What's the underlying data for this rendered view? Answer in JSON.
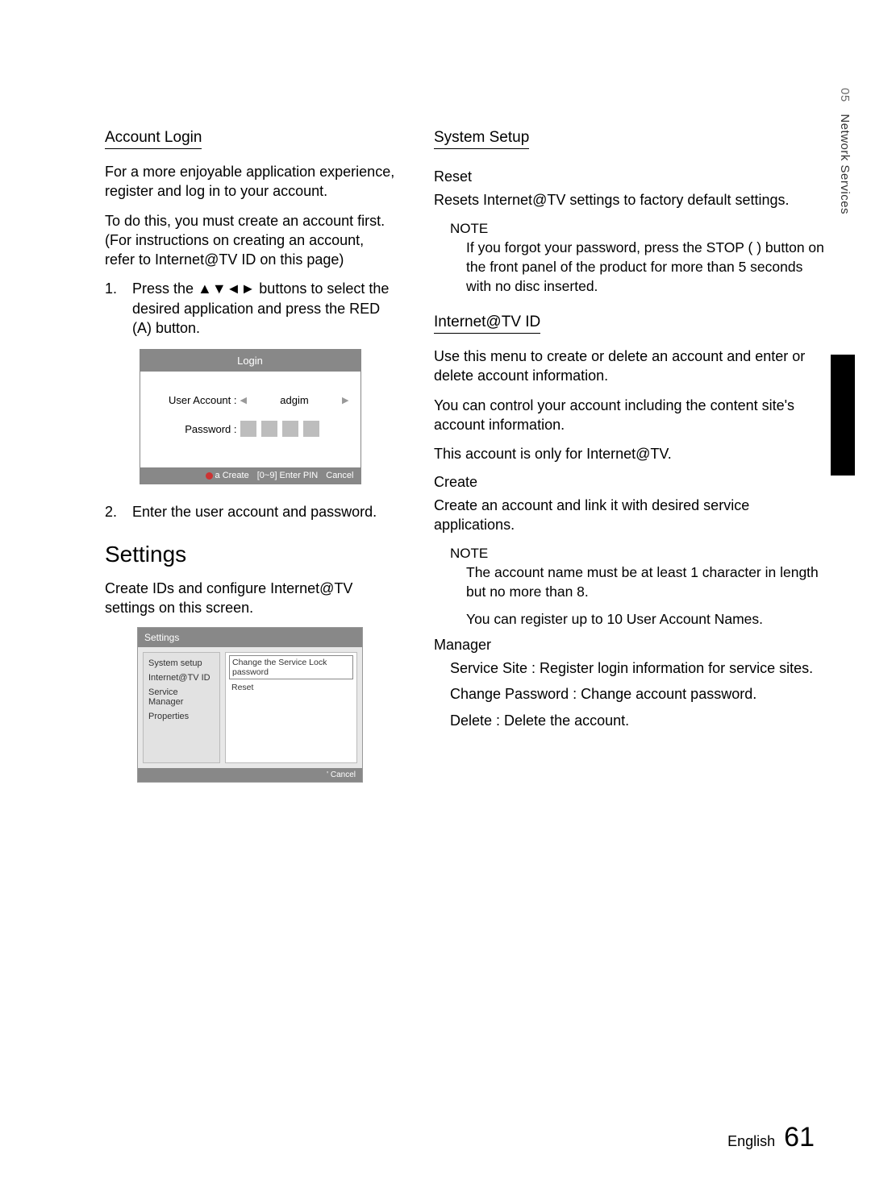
{
  "sideTab": {
    "chapter": "05",
    "name": "Network Services"
  },
  "left": {
    "accountLogin": {
      "title": "Account Login",
      "p1": "For a more enjoyable application experience, register and log in to your account.",
      "p2": "To do this, you must create an account first. (For instructions on creating an account, refer to Internet@TV ID on this page)",
      "step1_num": "1.",
      "step1": "Press the ▲▼◄► buttons to select the desired application and press the RED (A) button.",
      "step2_num": "2.",
      "step2": "Enter the user account and password."
    },
    "loginDialog": {
      "title": "Login",
      "userLabel": "User Account :",
      "userValue": "adgim",
      "passLabel": "Password :",
      "footerCreate": "a  Create",
      "footerEnter": "[0~9] Enter PIN",
      "footerCancel": "Cancel"
    },
    "settingsSection": {
      "title": "Settings",
      "desc": "Create IDs and configure Internet@TV settings on this screen."
    },
    "settingsDialog": {
      "title": "Settings",
      "side": [
        "System setup",
        "Internet@TV ID",
        "Service Manager",
        "Properties"
      ],
      "mainSel": "Change the Service Lock password",
      "mainOpt": "Reset",
      "footer": "'  Cancel"
    }
  },
  "right": {
    "systemSetup": {
      "title": "System Setup",
      "resetLabel": "Reset",
      "resetDesc": "Resets Internet@TV settings to factory default settings.",
      "noteLabel": "NOTE",
      "note": "If you forgot your password, press the STOP (   ) button on the front panel of the product for more than 5 seconds with no disc inserted."
    },
    "internetTv": {
      "title": "Internet@TV ID",
      "p1": "Use this menu to create or delete an account and enter or delete account information.",
      "p2": "You can control your account including the content site's account information.",
      "p3": "This account is only for Internet@TV.",
      "createLabel": "Create",
      "createDesc": "Create an account and link it with desired service applications.",
      "noteLabel": "NOTE",
      "note1": "The account name must be at least 1 character in length but no more than 8.",
      "note2": "You can register up to 10 User Account Names.",
      "managerLabel": "Manager",
      "m1": "Service Site : Register login information for service sites.",
      "m2": "Change Password : Change account password.",
      "m3": "Delete : Delete the account."
    }
  },
  "footer": {
    "lang": "English",
    "page": "61"
  }
}
